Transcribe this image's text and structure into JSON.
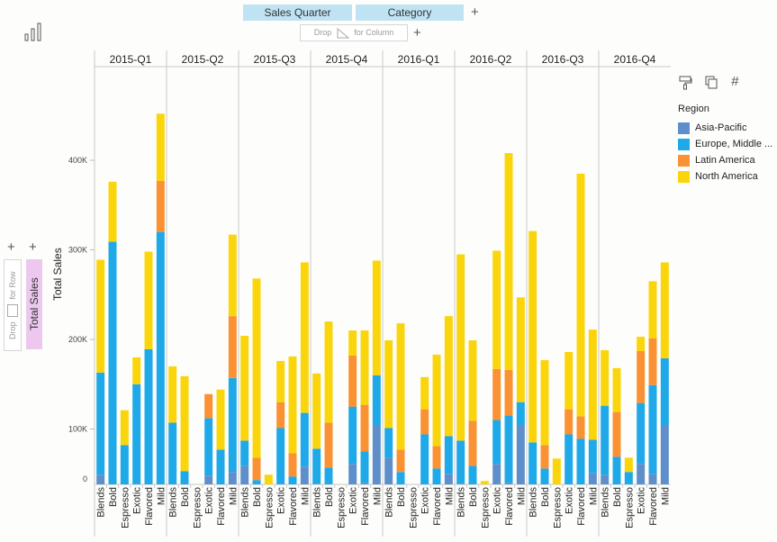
{
  "toolbar": {
    "column_fields": [
      "Sales Quarter",
      "Category"
    ],
    "add_column_label": "+",
    "drop_column_label_left": "Drop",
    "drop_column_label_right": "for Column",
    "drop_column_add": "+",
    "row_add_1": "+",
    "row_add_2": "+",
    "drop_row_label_left": "Drop",
    "drop_row_label_right": "for Row",
    "row_field": "Total Sales",
    "chart_type_icon": "bar-chart-icon"
  },
  "tools": {
    "format_icon": "paint-roller-icon",
    "copy_icon": "copy-icon",
    "number_format_icon": "hash-icon",
    "number_format_glyph": "#"
  },
  "legend": {
    "title": "Region",
    "items": [
      {
        "label": "Asia-Pacific",
        "color": "#5f8fcb"
      },
      {
        "label": "Europe, Middle ...",
        "color": "#1fa9e8"
      },
      {
        "label": "Latin America",
        "color": "#fa9234"
      },
      {
        "label": "North America",
        "color": "#fbd50c"
      }
    ]
  },
  "chart_data": {
    "type": "bar",
    "stacked": true,
    "title": "",
    "xlabel": "",
    "ylabel": "Total Sales",
    "ylim": [
      0,
      465
    ],
    "y_unit": "K",
    "yticks": [
      {
        "v": 0,
        "label": "0"
      },
      {
        "v": 100,
        "label": "100K"
      },
      {
        "v": 200,
        "label": "200K"
      },
      {
        "v": 300,
        "label": "300K"
      },
      {
        "v": 400,
        "label": "400K"
      }
    ],
    "grid": false,
    "legend_position": "right",
    "panels": [
      "2015-Q1",
      "2015-Q2",
      "2015-Q3",
      "2015-Q4",
      "2016-Q1",
      "2016-Q2",
      "2016-Q3",
      "2016-Q4"
    ],
    "categories": [
      "Blends",
      "Bold",
      "Espresso",
      "Exotic",
      "Flavored",
      "Mild"
    ],
    "series_names": [
      "Asia-Pacific",
      "Europe, Middle East & Africa",
      "Latin America",
      "North America"
    ],
    "values": [
      [
        [
          49,
          114,
          0,
          126
        ],
        [
          0,
          309,
          0,
          67
        ],
        [
          0,
          82,
          0,
          39
        ],
        [
          0,
          150,
          0,
          30
        ],
        [
          0,
          189,
          0,
          109
        ],
        [
          0,
          320,
          57,
          75
        ]
      ],
      [
        [
          0,
          107,
          0,
          63
        ],
        [
          0,
          53,
          0,
          106
        ],
        [
          0,
          0,
          0,
          0
        ],
        [
          48,
          64,
          27,
          0
        ],
        [
          0,
          77,
          0,
          67
        ],
        [
          52,
          105,
          69,
          91
        ]
      ],
      [
        [
          59,
          28,
          0,
          117
        ],
        [
          0,
          43,
          25,
          200
        ],
        [
          0,
          0,
          0,
          49
        ],
        [
          0,
          101,
          29,
          46
        ],
        [
          0,
          47,
          26,
          108
        ],
        [
          58,
          60,
          0,
          168
        ]
      ],
      [
        [
          39,
          39,
          0,
          84
        ],
        [
          0,
          57,
          50,
          113
        ],
        [
          0,
          0,
          0,
          0
        ],
        [
          61,
          64,
          57,
          28
        ],
        [
          40,
          35,
          52,
          83
        ],
        [
          104,
          56,
          0,
          128
        ]
      ],
      [
        [
          68,
          33,
          0,
          98
        ],
        [
          0,
          52,
          25,
          141
        ],
        [
          0,
          0,
          0,
          0
        ],
        [
          0,
          94,
          28,
          36
        ],
        [
          0,
          56,
          25,
          102
        ],
        [
          50,
          42,
          0,
          134
        ]
      ],
      [
        [
          39,
          48,
          0,
          208
        ],
        [
          0,
          59,
          50,
          90
        ],
        [
          0,
          0,
          0,
          42
        ],
        [
          61,
          49,
          57,
          132
        ],
        [
          40,
          75,
          51,
          242
        ],
        [
          104,
          26,
          0,
          117
        ]
      ],
      [
        [
          0,
          85,
          0,
          236
        ],
        [
          0,
          56,
          26,
          95
        ],
        [
          0,
          0,
          0,
          67
        ],
        [
          0,
          94,
          28,
          64
        ],
        [
          0,
          89,
          25,
          271
        ],
        [
          51,
          37,
          0,
          123
        ]
      ],
      [
        [
          49,
          77,
          0,
          62
        ],
        [
          0,
          69,
          50,
          49
        ],
        [
          0,
          52,
          0,
          16
        ],
        [
          61,
          68,
          58,
          16
        ],
        [
          50,
          99,
          52,
          64
        ],
        [
          104,
          75,
          0,
          107
        ]
      ]
    ]
  }
}
